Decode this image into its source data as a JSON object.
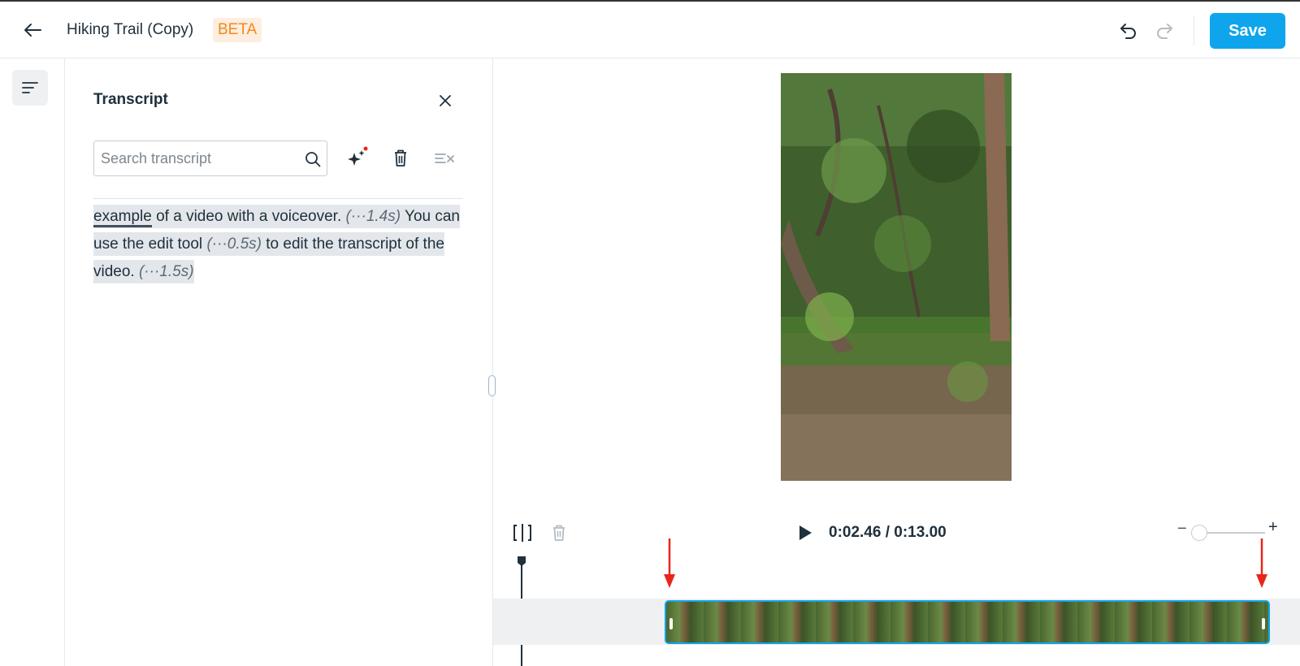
{
  "header": {
    "title": "Hiking Trail (Copy)",
    "badge": "BETA",
    "save_label": "Save"
  },
  "panel": {
    "title": "Transcript",
    "search_placeholder": "Search transcript"
  },
  "transcript": {
    "segments": [
      {
        "type": "word",
        "text": "example",
        "current": true
      },
      {
        "type": "text",
        "text": " of a video with a voiceover. "
      },
      {
        "type": "pause",
        "text": "(···1.4s)"
      },
      {
        "type": "text",
        "text": " You can use the edit tool "
      },
      {
        "type": "pause",
        "text": "(···0.5s)"
      },
      {
        "type": "text",
        "text": " to edit the transcript of the video. "
      },
      {
        "type": "pause",
        "text": "(···1.5s)"
      }
    ]
  },
  "player": {
    "timecode": "0:02.46 / 0:13.00",
    "zoom_minus": "−",
    "zoom_plus": "+"
  },
  "icons": {
    "back": "arrow-left-icon",
    "undo": "undo-icon",
    "redo": "redo-icon",
    "rail": "transcript-lines-icon",
    "close": "close-icon",
    "search": "search-icon",
    "ai": "sparkle-icon",
    "delete": "trash-icon",
    "clear": "clear-format-icon",
    "split": "split-icon",
    "play": "play-icon"
  },
  "colors": {
    "accent": "#0ea5ec",
    "beta_text": "#f08a1a",
    "beta_bg": "#fdeee0",
    "annotation": "#e8261b"
  }
}
